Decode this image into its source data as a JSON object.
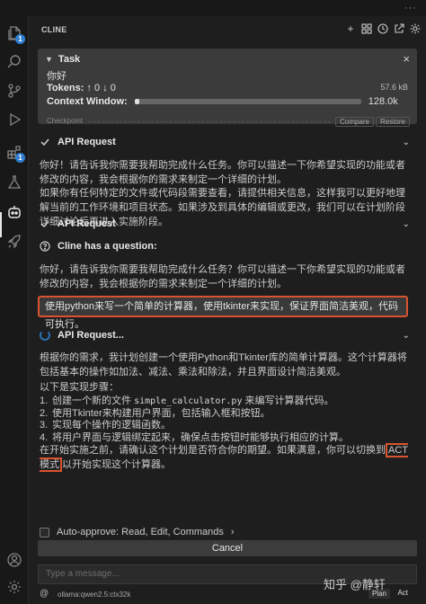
{
  "window": {
    "menu_dots": "···"
  },
  "activity_bar": {
    "icons": [
      "files-icon",
      "search-icon",
      "source-control-icon",
      "run-debug-icon",
      "extensions-icon",
      "test-flask-icon",
      "cline-robot-icon",
      "rocket-icon"
    ],
    "explorer_badge": "1",
    "extensions_badge": "1"
  },
  "panel": {
    "title": "CLINE",
    "header_icons": [
      "plus-icon",
      "mcp-servers-icon",
      "history-icon",
      "external-icon",
      "settings-icon"
    ]
  },
  "task": {
    "heading": "Task",
    "text": "你好",
    "tokens_label": "Tokens:",
    "tokens_value": "↑ 0 ↓ 0",
    "size": "57.6 kB",
    "context_label": "Context Window:",
    "context_max": "128.0k",
    "context_used_fraction": 0.02
  },
  "checkpoint": {
    "label": "Checkpoint",
    "compare": "Compare",
    "restore": "Restore"
  },
  "messages": {
    "api1_title": "API Request",
    "reply1": "你好！请告诉我你需要我帮助完成什么任务。你可以描述一下你希望实现的功能或者修改的内容，我会根据你的需求来制定一个详细的计划。",
    "reply2": "如果你有任何特定的文件或代码段需要查看，请提供相关信息，这样我可以更好地理解当前的工作环境和项目状态。如果涉及到具体的编辑或更改，我们可以在计划阶段详细讨论后再进入实施阶段。",
    "api2_title": "API Request",
    "question_title": "Cline has a question:",
    "question_text": "你好，请告诉我你需要我帮助完成什么任务？你可以描述一下你希望实现的功能或者修改的内容，我会根据你的需求来制定一个详细的计划。",
    "user_message": "使用python来写一个简单的计算器，使用tkinter来实现，保证界面简洁美观，代码可执行。",
    "api3_title": "API Request...",
    "plan_intro": "根据你的需求，我计划创建一个使用Python和Tkinter库的简单计算器。这个计算器将包括基本的操作如加法、减法、乘法和除法，并且界面设计简洁美观。",
    "steps_title": "以下是实现步骤：",
    "step1_pre": "创建一个新的文件",
    "step1_code": "simple_calculator.py",
    "step1_post": "来编写计算器代码。",
    "step2": "使用Tkinter来构建用户界面，包括输入框和按钮。",
    "step3": "实现每个操作的逻辑函数。",
    "step4": "将用户界面与逻辑绑定起来，确保点击按钮时能够执行相应的计算。",
    "closing_pre": "在开始实施之前，请确认这个计划是否符合你的期望。如果满意，你可以切换到",
    "closing_act": "ACT模式",
    "closing_post": "以开始实现这个计算器。"
  },
  "bottom": {
    "auto_approve": "Auto-approve: Read, Edit, Commands",
    "cancel": "Cancel",
    "input_placeholder": "Type a message...",
    "model": "ollama:qwen2.5:ctx32k",
    "plan": "Plan",
    "act": "Act"
  },
  "watermark": "知乎 @静轩"
}
